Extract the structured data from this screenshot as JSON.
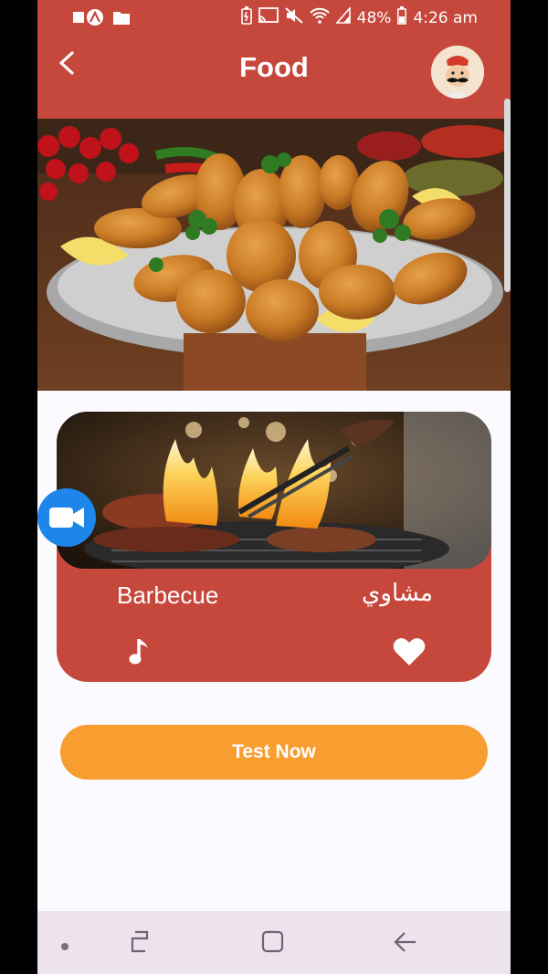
{
  "status_bar": {
    "battery_percent": "48%",
    "time": "4:26 am",
    "icons": [
      "notification-a-icon",
      "folder-icon",
      "battery-saver-icon",
      "cast-icon",
      "mute-icon",
      "wifi-icon",
      "signal-icon",
      "battery-icon"
    ]
  },
  "app_bar": {
    "title": "Food",
    "back_icon": "chevron-left-icon",
    "avatar": "chef-avatar"
  },
  "card": {
    "name_en": "Barbecue",
    "name_ar": "مشاوي",
    "music_icon": "music-note-icon",
    "favorite_icon": "heart-icon"
  },
  "floating_button": {
    "icon": "video-camera-icon"
  },
  "cta": {
    "label": "Test Now"
  },
  "nav_bar": {
    "items": [
      "dot",
      "recent-apps-icon",
      "home-icon",
      "back-icon"
    ]
  },
  "colors": {
    "brand_red": "#c6483d",
    "cta_orange": "#f89d2f",
    "fab_blue": "#1d86ea",
    "page_bg": "#fbfafe",
    "navbar_bg": "#ece3ed"
  }
}
